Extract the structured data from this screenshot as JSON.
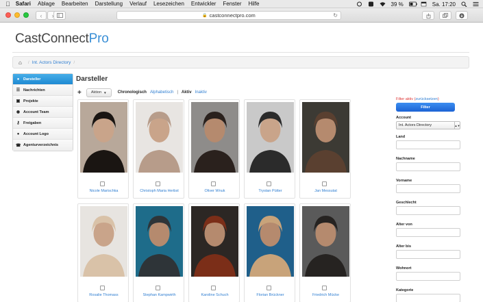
{
  "os_menubar": {
    "items": [
      "Safari",
      "Ablage",
      "Bearbeiten",
      "Darstellung",
      "Verlauf",
      "Lesezeichen",
      "Entwickler",
      "Fenster",
      "Hilfe"
    ],
    "battery": "39 %",
    "clock": "Sa. 17:20"
  },
  "browser": {
    "url": "castconnectpro.com"
  },
  "site": {
    "logo_main": "CastConnect",
    "logo_accent": "Pro",
    "breadcrumb": [
      "Int. Actors Directory"
    ]
  },
  "sidebar": {
    "items": [
      {
        "label": "Darsteller",
        "icon": "user-icon",
        "active": true
      },
      {
        "label": "Nachrichten",
        "icon": "list-icon"
      },
      {
        "label": "Projekte",
        "icon": "document-icon"
      },
      {
        "label": "Account Team",
        "icon": "eye-icon"
      },
      {
        "label": "Freigaben",
        "icon": "key-icon"
      },
      {
        "label": "Account Logo",
        "icon": "user-icon"
      },
      {
        "label": "Agenturverzeichnis",
        "icon": "phone-icon"
      }
    ]
  },
  "main": {
    "title": "Darsteller",
    "add_label": "+",
    "action_label": "Aktion",
    "sort_chronological": "Chronologisch",
    "sort_alphabetical": "Alphabetisch",
    "separator": "|",
    "filter_active": "Aktiv",
    "filter_inactive": "Inaktiv"
  },
  "actors": [
    {
      "name": "Nicole Marischka",
      "tone": "#1a1512",
      "bg": "#b8a89a"
    },
    {
      "name": "Christoph Maria Herbst",
      "tone": "#b79c8a",
      "bg": "#e8e5e2"
    },
    {
      "name": "Oliver Wnuk",
      "tone": "#2a211d",
      "bg": "#8e8c8a"
    },
    {
      "name": "Trystan Pütter",
      "tone": "#2b2b2b",
      "bg": "#c9c9c9"
    },
    {
      "name": "Jan Messutat",
      "tone": "#5a4030",
      "bg": "#3c3a34"
    },
    {
      "name": "Rosalie Thomass",
      "tone": "#d9c2a8",
      "bg": "#e7e4e0"
    },
    {
      "name": "Stephan Kampwirth",
      "tone": "#2e3438",
      "bg": "#1e6c8a"
    },
    {
      "name": "Karoline Schuch",
      "tone": "#7b2e18",
      "bg": "#2c2724"
    },
    {
      "name": "Florian Brückner",
      "tone": "#c8a37a",
      "bg": "#1f5f8a"
    },
    {
      "name": "Friedrich Mücke",
      "tone": "#262321",
      "bg": "#5a5a5a"
    }
  ],
  "filter": {
    "status_prefix": "Filter aktiv (",
    "reset_label": "zurücksetzen",
    "status_suffix": ")",
    "button_label": "Filter",
    "account_label": "Account",
    "account_value": "Int. Actors Directory",
    "fields": [
      "Land",
      "Nachname",
      "Vorname",
      "Geschlecht",
      "Alter von",
      "Alter bis",
      "Wohnort",
      "Kategorie"
    ]
  }
}
